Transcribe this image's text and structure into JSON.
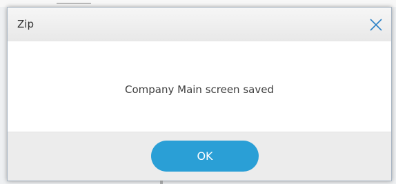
{
  "dialog": {
    "title": "Zip",
    "message": "Company Main screen saved",
    "ok_label": "OK",
    "close_icon": "close-icon"
  },
  "colors": {
    "accent": "#2a9fd6",
    "titlebar": "#eeeeee",
    "footer": "#ececec",
    "close_icon": "#2a80c6"
  }
}
